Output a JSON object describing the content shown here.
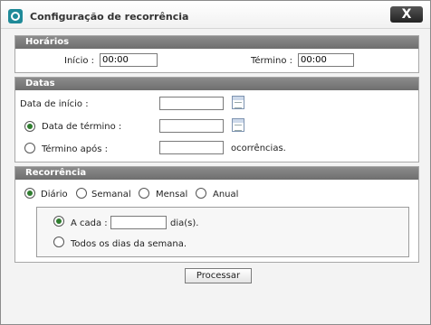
{
  "window": {
    "title": "Configuração de recorrência",
    "close_label": "X"
  },
  "horarios": {
    "header": "Horários",
    "inicio_label": "Início :",
    "inicio_value": "00:00",
    "termino_label": "Término :",
    "termino_value": "00:00"
  },
  "datas": {
    "header": "Datas",
    "data_inicio_label": "Data de início :",
    "data_inicio_value": "",
    "data_termino_label": "Data de término :",
    "data_termino_value": "",
    "data_termino_selected": true,
    "termino_apos_label": "Término após :",
    "termino_apos_value": "",
    "termino_apos_selected": false,
    "ocorrencias_label": "ocorrências."
  },
  "recorrencia": {
    "header": "Recorrência",
    "options": [
      {
        "label": "Diário",
        "selected": true
      },
      {
        "label": "Semanal",
        "selected": false
      },
      {
        "label": "Mensal",
        "selected": false
      },
      {
        "label": "Anual",
        "selected": false
      }
    ],
    "a_cada_label": "A cada :",
    "a_cada_value": "",
    "a_cada_selected": true,
    "dias_label": "dia(s).",
    "todos_label": "Todos os dias da semana.",
    "todos_selected": false
  },
  "actions": {
    "processar_label": "Processar"
  },
  "colors": {
    "accent": "#1f8a98",
    "panel_header": "#7d7d7d",
    "radio_check": "#2f7d2f"
  }
}
